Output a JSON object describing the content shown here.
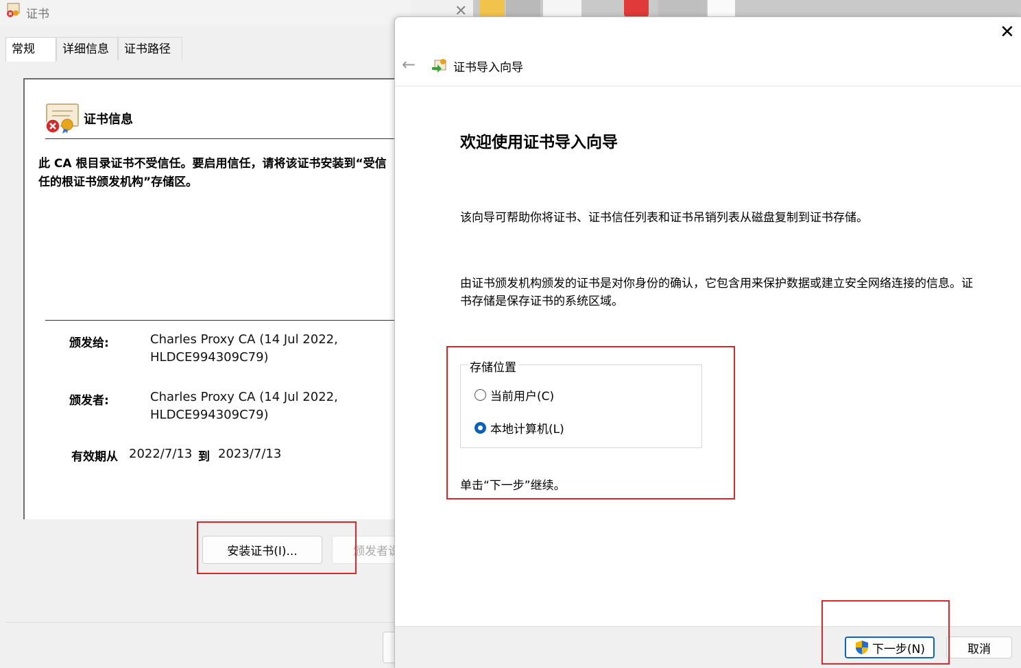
{
  "cert_window": {
    "title": "证书",
    "tabs": [
      {
        "label": "常规",
        "active": true
      },
      {
        "label": "详细信息",
        "active": false
      },
      {
        "label": "证书路径",
        "active": false
      }
    ],
    "info_title": "证书信息",
    "warning_line1": "此 CA 根目录证书不受信任。要启用信任，请将该证书安装到“受信",
    "warning_line2": "任的根证书颁发机构”存储区。",
    "issued_to_label": "颁发给:",
    "issued_to_value_1": "Charles Proxy CA (14 Jul 2022,",
    "issued_to_value_2": "HLDCE994309C79)",
    "issued_by_label": "颁发者:",
    "issued_by_value_1": "Charles Proxy CA (14 Jul 2022,",
    "issued_by_value_2": "HLDCE994309C79)",
    "validity_label": "有效期从",
    "valid_from": "2022/7/13",
    "validity_to": "到",
    "valid_to": "2023/7/13",
    "install_button": "安装证书(I)...",
    "issuer_statement_button": "颁发者说明"
  },
  "wizard": {
    "title": "证书导入向导",
    "heading": "欢迎使用证书导入向导",
    "description_1": "该向导可帮助你将证书、证书信任列表和证书吊销列表从磁盘复制到证书存储。",
    "description_2": "由证书颁发机构颁发的证书是对你身份的确认，它包含用来保护数据或建立安全网络连接的信息。证书存储是保存证书的系统区域。",
    "store_location_label": "存储位置",
    "options": [
      {
        "label": "当前用户(C)",
        "checked": false
      },
      {
        "label": "本地计算机(L)",
        "checked": true
      }
    ],
    "continue_hint": "单击“下一步”继续。",
    "next_button": "下一步(N)",
    "cancel_button": "取消"
  },
  "colors": {
    "highlight_red": "#d9262b",
    "accent_blue": "#0a64c8"
  }
}
